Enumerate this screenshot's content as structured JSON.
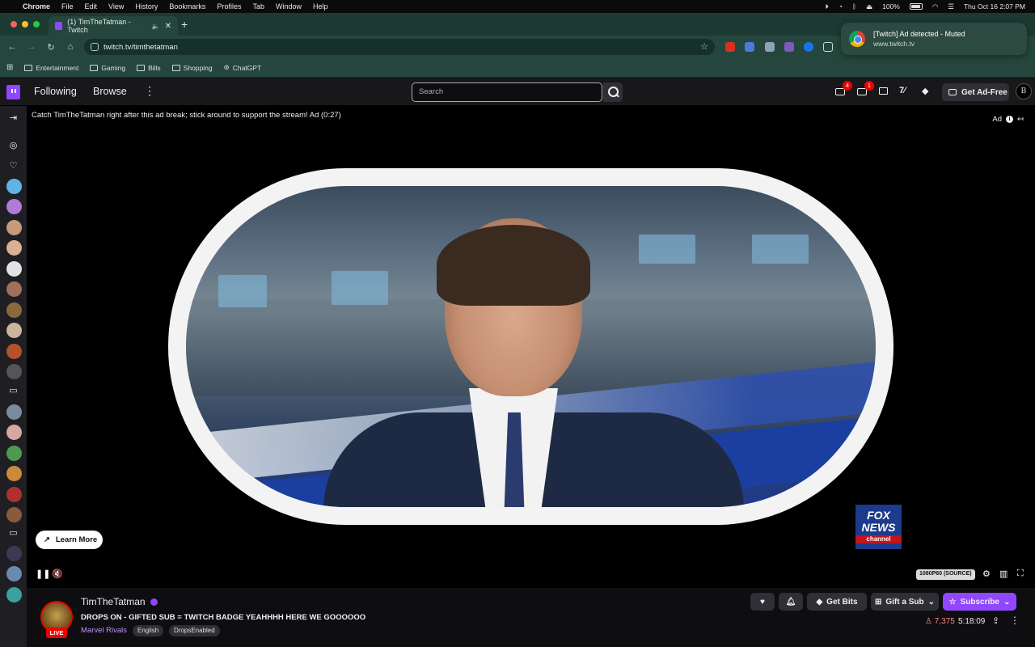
{
  "menubar": {
    "apple": "",
    "app": "Chrome",
    "items": [
      "File",
      "Edit",
      "View",
      "History",
      "Bookmarks",
      "Profiles",
      "Tab",
      "Window",
      "Help"
    ],
    "battery": "100%",
    "datetime": "Thu Oct 16  2:07 PM"
  },
  "tab": {
    "title": "(1) TimTheTatman - Twitch",
    "close": "✕",
    "new": "+"
  },
  "address": {
    "url": "twitch.tv/timthetatman"
  },
  "bookmarks": [
    {
      "label": "Entertainment"
    },
    {
      "label": "Gaming"
    },
    {
      "label": "Bills"
    },
    {
      "label": "Shopping"
    },
    {
      "label": "ChatGPT"
    }
  ],
  "notification": {
    "title": "[Twitch] Ad detected - Muted",
    "source": "www.twitch.tv"
  },
  "twitch_nav": {
    "following": "Following",
    "browse": "Browse",
    "search_placeholder": "Search",
    "notif_badge_1": "4",
    "notif_badge_2": "1",
    "ad_free": "Get Ad-Free",
    "avatar_letter": "B"
  },
  "player": {
    "ad_text": "Catch TimTheTatman right after this ad break; stick around to support the stream! Ad (0:27)",
    "ad_label": "Ad",
    "learn_more": "Learn More",
    "quality": "1080P60 (SOURCE)",
    "fox_line1": "FOX",
    "fox_line2": "NEWS",
    "fox_line3": "channel"
  },
  "stream": {
    "streamer": "TimTheTatman",
    "live": "LIVE",
    "title": "DROPS ON - GIFTED SUB = TWITCH BADGE YEAHHHH HERE WE GOOOOOO",
    "game": "Marvel Rivals",
    "tags": [
      "English",
      "DropsEnabled"
    ],
    "get_bits": "Get Bits",
    "gift_sub": "Gift a Sub",
    "subscribe": "Subscribe",
    "viewers": "7,375",
    "uptime": "5:18:09"
  },
  "colors": {
    "twitch_purple": "#9146ff",
    "live_red": "#eb0400",
    "chrome_green": "#25463d"
  }
}
